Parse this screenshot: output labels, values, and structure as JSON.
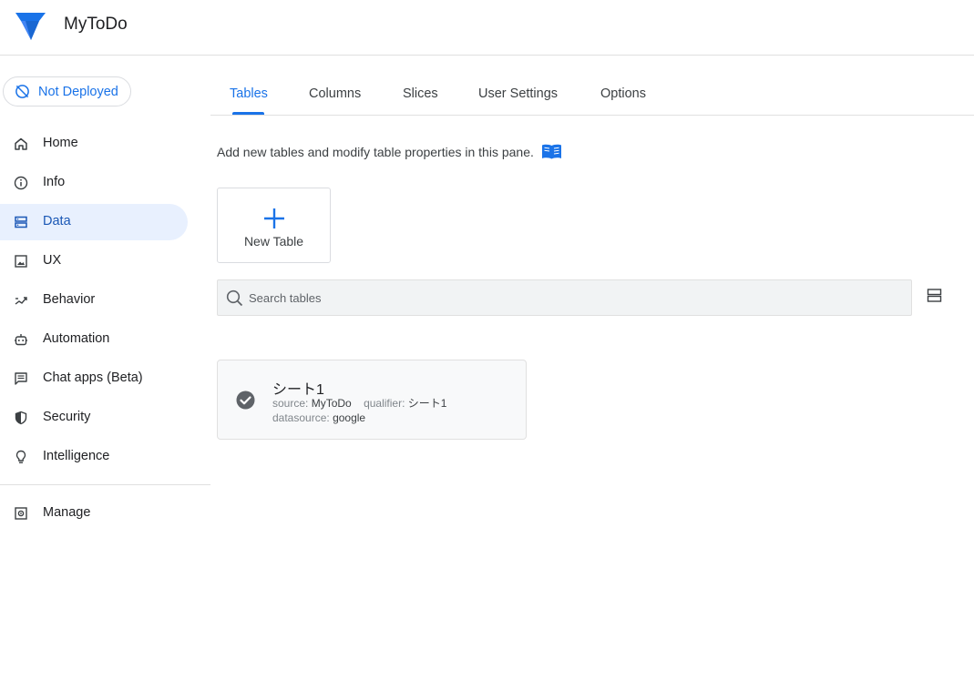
{
  "app": {
    "title": "MyToDo"
  },
  "sidebar": {
    "deploy_status": "Not Deployed",
    "items": [
      {
        "label": "Home",
        "icon": "home-icon",
        "active": false
      },
      {
        "label": "Info",
        "icon": "info-icon",
        "active": false
      },
      {
        "label": "Data",
        "icon": "data-icon",
        "active": true
      },
      {
        "label": "UX",
        "icon": "ux-icon",
        "active": false
      },
      {
        "label": "Behavior",
        "icon": "behavior-icon",
        "active": false
      },
      {
        "label": "Automation",
        "icon": "robot-icon",
        "active": false
      },
      {
        "label": "Chat apps (Beta)",
        "icon": "chat-icon",
        "active": false
      },
      {
        "label": "Security",
        "icon": "shield-icon",
        "active": false
      },
      {
        "label": "Intelligence",
        "icon": "lightbulb-icon",
        "active": false
      }
    ],
    "manage": {
      "label": "Manage",
      "icon": "manage-icon"
    }
  },
  "tabs": [
    {
      "label": "Tables",
      "active": true
    },
    {
      "label": "Columns",
      "active": false
    },
    {
      "label": "Slices",
      "active": false
    },
    {
      "label": "User Settings",
      "active": false
    },
    {
      "label": "Options",
      "active": false
    }
  ],
  "main": {
    "intro_text": "Add new tables and modify table properties in this pane.",
    "new_table_label": "New Table",
    "search_placeholder": "Search tables",
    "tables": [
      {
        "name": "シート1",
        "source_key": "source:",
        "source_value": "MyToDo",
        "qualifier_key": "qualifier:",
        "qualifier_value": "シート1",
        "datasource_key": "datasource:",
        "datasource_value": "google"
      }
    ]
  },
  "colors": {
    "accent": "#1a73e8",
    "active_nav_bg": "#e8f0fe",
    "search_bg": "#f1f3f4",
    "card_bg": "#f8f9fa"
  }
}
